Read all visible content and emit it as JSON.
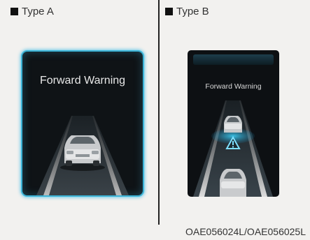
{
  "panels": [
    {
      "type_label": "Type A",
      "display_text": "Forward Warning"
    },
    {
      "type_label": "Type B",
      "display_text": "Forward Warning"
    }
  ],
  "caption": "OAE056024L/OAE056025L",
  "colors": {
    "accent": "#3bb3d6",
    "screen_bg": "#0f1316",
    "page_bg": "#f2f1ef"
  },
  "icons": {
    "type_marker": "square-icon",
    "warning": "warning-triangle-icon"
  }
}
